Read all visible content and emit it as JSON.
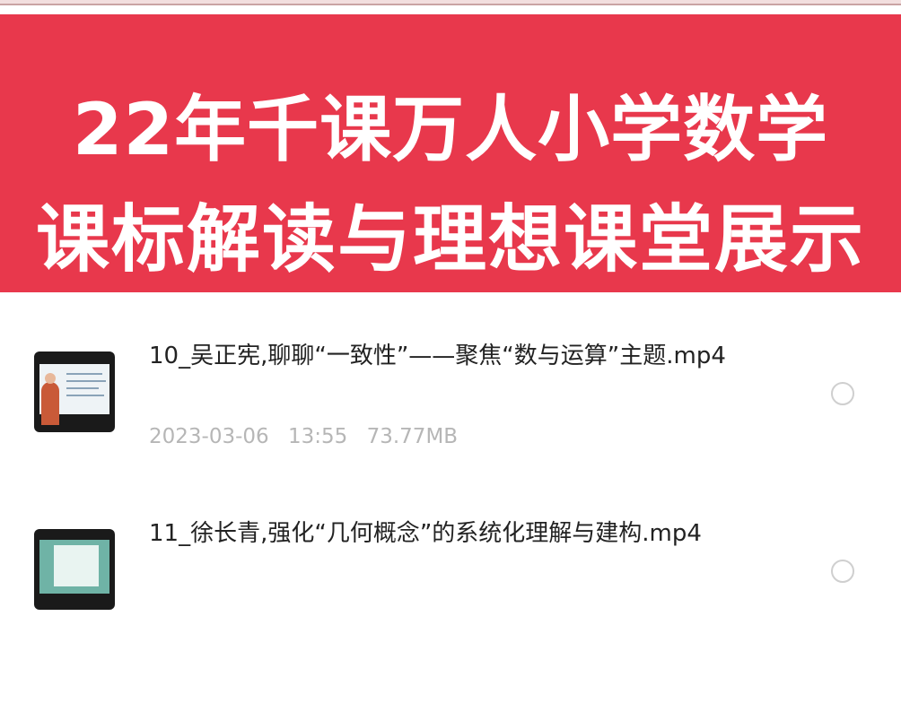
{
  "banner": {
    "line1": "22年千课万人小学数学",
    "line2": "课标解读与理想课堂展示",
    "background_color": "#e8384c"
  },
  "files": [
    {
      "title": "10_吴正宪,聊聊“一致性”——聚焦“数与运算”主题.mp4",
      "date": "2023-03-06",
      "time": "13:55",
      "size": "73.77MB",
      "thumbnail_icon": "video-thumbnail-icon",
      "selected": false
    },
    {
      "title": "11_徐长青,强化“几何概念”的系统化理解与建构.mp4",
      "thumbnail_icon": "video-thumbnail-icon",
      "selected": false
    }
  ]
}
